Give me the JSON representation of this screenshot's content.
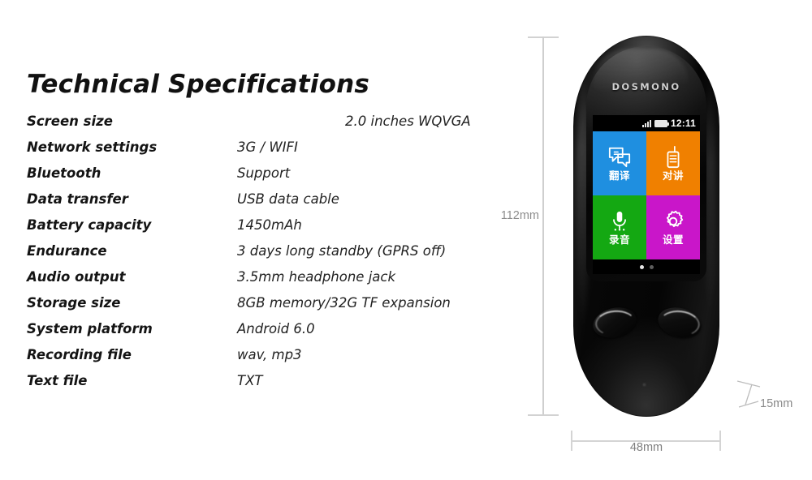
{
  "spec_sheet": {
    "title": "Technical Specifications",
    "rows": [
      {
        "label": "Screen size",
        "value": "2.0 inches WQVGA",
        "wide": true
      },
      {
        "label": "Network settings",
        "value": "3G / WIFI",
        "wide": false
      },
      {
        "label": "Bluetooth",
        "value": "Support",
        "wide": false
      },
      {
        "label": "Data transfer",
        "value": "USB data cable",
        "wide": false
      },
      {
        "label": "Battery capacity",
        "value": "1450mAh",
        "wide": false
      },
      {
        "label": "Endurance",
        "value": "3 days long standby (GPRS off)",
        "wide": false
      },
      {
        "label": "Audio output",
        "value": "3.5mm headphone jack",
        "wide": false
      },
      {
        "label": "Storage size",
        "value": "8GB memory/32G TF expansion",
        "wide": false
      },
      {
        "label": "System platform",
        "value": "Android 6.0",
        "wide": false
      },
      {
        "label": "Recording file",
        "value": "wav, mp3",
        "wide": false
      },
      {
        "label": "Text file",
        "value": "TXT",
        "wide": false
      }
    ]
  },
  "device": {
    "brand": "DOSMONO",
    "status_bar": {
      "signal_icon": "signal-bars-icon",
      "battery_icon": "battery-icon",
      "clock": "12:11"
    },
    "tiles": [
      {
        "label": "翻译",
        "icon": "speech-bubbles-icon",
        "color": "#1f8fe0"
      },
      {
        "label": "对讲",
        "icon": "walkie-talkie-icon",
        "color": "#f08000"
      },
      {
        "label": "录音",
        "icon": "microphone-icon",
        "color": "#14a812"
      },
      {
        "label": "设置",
        "icon": "gear-icon",
        "color": "#c916c9"
      }
    ],
    "page_dots": {
      "count": 2,
      "active_index": 0
    },
    "hardware_buttons": [
      "left-oval-button",
      "right-oval-button"
    ],
    "mic": "microphone-pinhole"
  },
  "dimensions": {
    "height": "112mm",
    "width": "48mm",
    "thickness": "15mm"
  }
}
